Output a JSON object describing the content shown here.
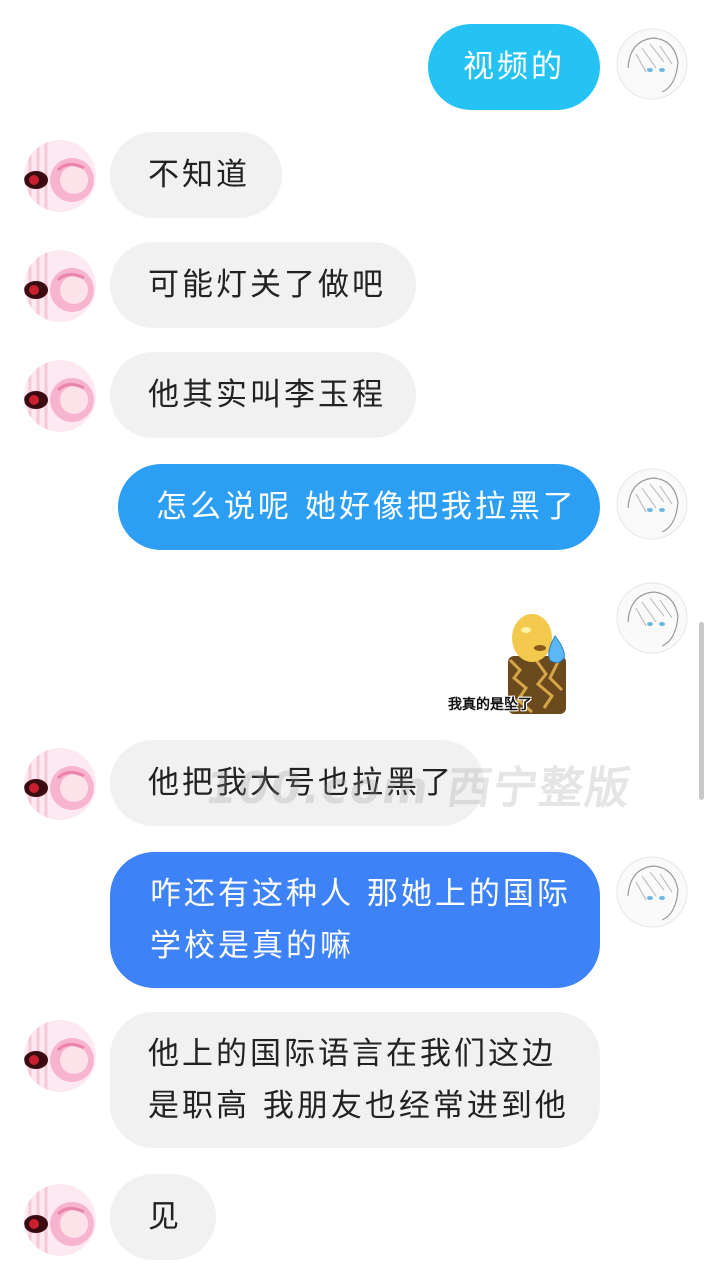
{
  "colors": {
    "incoming_bubble": "#f1f1f1",
    "outgoing_cyan": "#25c3f4",
    "outgoing_blue": "#2c9ff5",
    "outgoing_royal": "#3d82f7"
  },
  "messages": [
    {
      "dir": "out",
      "text": "视频的"
    },
    {
      "dir": "in",
      "text": "不知道"
    },
    {
      "dir": "in",
      "text": "可能灯关了做吧"
    },
    {
      "dir": "in",
      "text": "他其实叫李玉程"
    },
    {
      "dir": "out",
      "text": "怎么说呢 她好像把我拉黑了"
    },
    {
      "dir": "out",
      "sticker_caption": "我真的是坠了",
      "sticker_icon": "bald-man-sweat-drop-sticker"
    },
    {
      "dir": "in",
      "text": "他把我大号也拉黑了"
    },
    {
      "dir": "out",
      "lines": [
        "咋还有这种人 那她上的国际",
        "学校是真的嘛"
      ]
    },
    {
      "dir": "in",
      "lines": [
        "他上的国际语言在我们这边",
        "是职高 我朋友也经常进到他"
      ]
    },
    {
      "dir": "in",
      "text": "见"
    }
  ],
  "watermark": "100.com 西宁整版"
}
